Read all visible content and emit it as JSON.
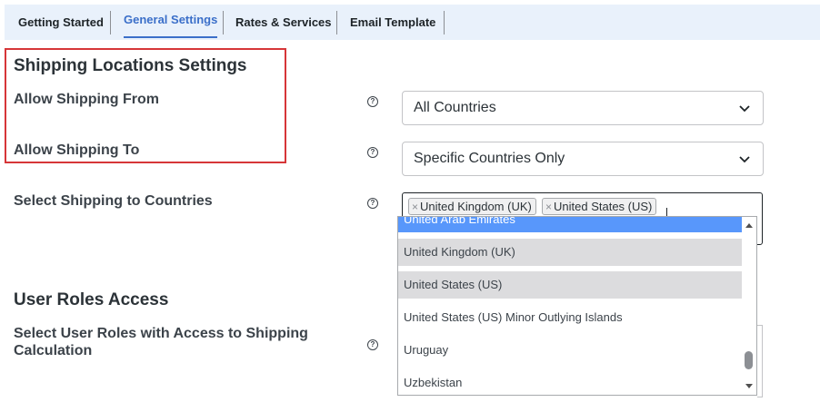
{
  "tabs": [
    {
      "label": "Getting Started",
      "active": false
    },
    {
      "label": "General Settings",
      "active": true
    },
    {
      "label": "Rates & Services",
      "active": false
    },
    {
      "label": "Email Template",
      "active": false
    }
  ],
  "shipping_locations": {
    "title": "Shipping Locations Settings",
    "allow_from": {
      "label": "Allow Shipping From",
      "value": "All Countries"
    },
    "allow_to": {
      "label": "Allow Shipping To",
      "value": "Specific Countries Only"
    },
    "select_countries": {
      "label": "Select Shipping to Countries",
      "selected_tags": [
        "United Kingdom (UK)",
        "United States (US)"
      ],
      "dropdown_options": [
        {
          "label": "United Arab Emirates",
          "state": "highlighted"
        },
        {
          "label": "United Kingdom (UK)",
          "state": "selected"
        },
        {
          "label": "United States (US)",
          "state": "selected"
        },
        {
          "label": "United States (US) Minor Outlying Islands",
          "state": "normal"
        },
        {
          "label": "Uruguay",
          "state": "normal"
        },
        {
          "label": "Uzbekistan",
          "state": "normal"
        }
      ]
    }
  },
  "user_roles": {
    "title": "User Roles Access",
    "select_roles": {
      "label_line1": "Select User Roles with Access to Shipping",
      "label_line2": "Calculation"
    }
  },
  "icons": {
    "help": "help-circle-icon",
    "chevron": "chevron-down-icon",
    "remove": "remove-tag-icon"
  },
  "colors": {
    "accent": "#3b6fc9",
    "highlight_border": "#d63638",
    "tab_bar": "#e9f1fb",
    "option_highlight": "#5897fb",
    "option_selected": "#dcdcde"
  }
}
